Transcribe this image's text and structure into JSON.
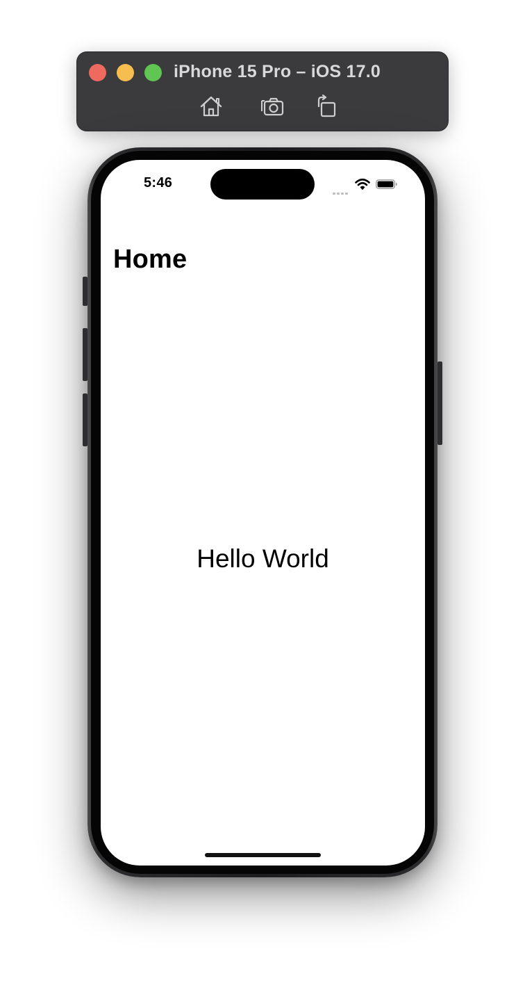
{
  "simulator": {
    "title": "iPhone 15 Pro – iOS 17.0",
    "toolbar": [
      {
        "icon": "home-icon",
        "label": "Home"
      },
      {
        "icon": "screenshot-icon",
        "label": "Screenshot"
      },
      {
        "icon": "rotate-icon",
        "label": "Rotate"
      }
    ],
    "traffic_lights": {
      "close": "#ee6a5e",
      "minimize": "#f5be4f",
      "zoom": "#61c554"
    }
  },
  "status_bar": {
    "time": "5:46",
    "icons": [
      "cellular-signal-icon",
      "wifi-icon",
      "battery-icon"
    ]
  },
  "screen": {
    "nav_title": "Home",
    "content_text": "Hello World"
  }
}
